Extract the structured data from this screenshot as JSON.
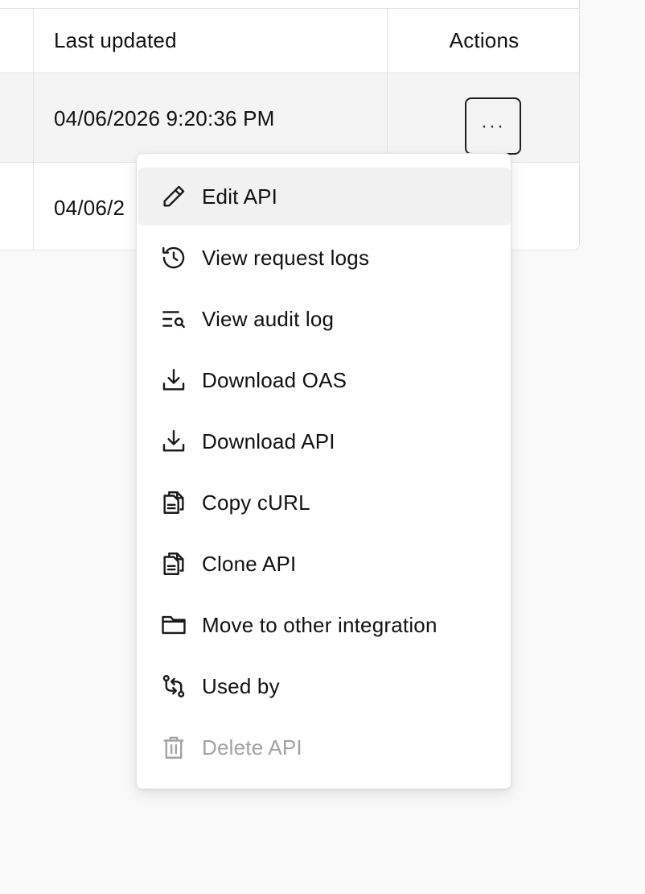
{
  "table": {
    "headers": {
      "last_updated": "Last updated",
      "actions": "Actions"
    },
    "rows": [
      {
        "last_updated": "04/06/2026 9:20:36 PM"
      },
      {
        "last_updated": "04/06/2"
      }
    ],
    "more_button_label": "···"
  },
  "menu": {
    "items": [
      {
        "label": "Edit API",
        "icon": "pencil-icon"
      },
      {
        "label": "View request logs",
        "icon": "history-icon"
      },
      {
        "label": "View audit log",
        "icon": "list-search-icon"
      },
      {
        "label": "Download OAS",
        "icon": "download-icon"
      },
      {
        "label": "Download API",
        "icon": "download-icon"
      },
      {
        "label": "Copy cURL",
        "icon": "copy-file-icon"
      },
      {
        "label": "Clone API",
        "icon": "copy-file-icon"
      },
      {
        "label": "Move to other integration",
        "icon": "folder-icon"
      },
      {
        "label": "Used by",
        "icon": "git-compare-icon"
      },
      {
        "label": "Delete API",
        "icon": "trash-icon",
        "disabled": true
      }
    ]
  },
  "colors": {
    "page_background": "#f9f9f9",
    "highlight": "#f1f1f1",
    "disabled_text": "#a3a3a3",
    "border": "#e4e4e4"
  }
}
